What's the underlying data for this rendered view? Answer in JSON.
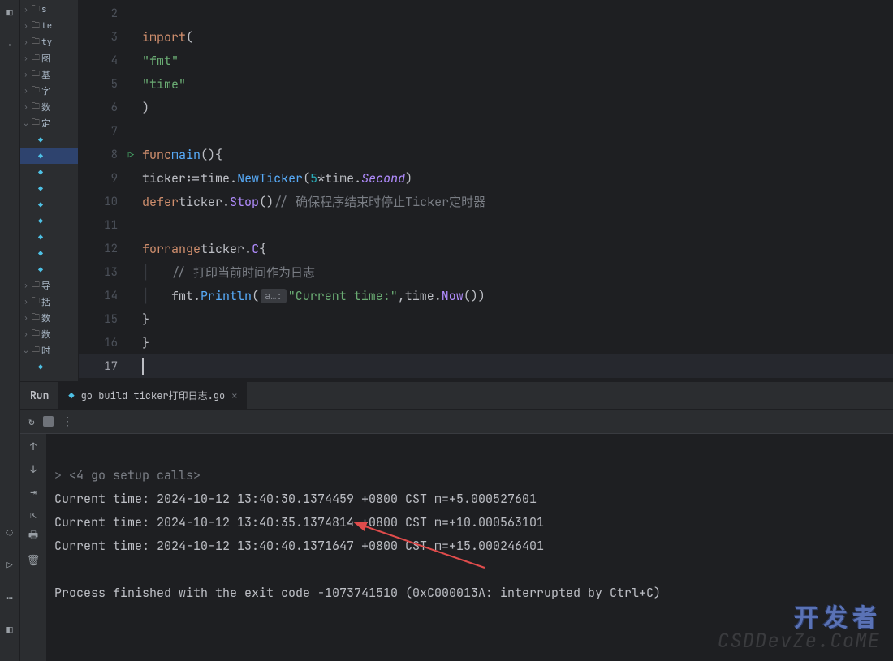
{
  "project_tree": {
    "items": [
      {
        "kind": "folder",
        "chevron": ">",
        "label": "s"
      },
      {
        "kind": "folder",
        "chevron": ">",
        "label": "te"
      },
      {
        "kind": "folder",
        "chevron": ">",
        "label": "ty"
      },
      {
        "kind": "folder",
        "chevron": ">",
        "label": "图"
      },
      {
        "kind": "folder",
        "chevron": ">",
        "label": "基"
      },
      {
        "kind": "folder",
        "chevron": ">",
        "label": "字"
      },
      {
        "kind": "folder",
        "chevron": ">",
        "label": "数"
      },
      {
        "kind": "folder",
        "chevron": "v",
        "label": "定"
      },
      {
        "kind": "go",
        "label": ""
      },
      {
        "kind": "go",
        "label": "",
        "selected": true
      },
      {
        "kind": "go",
        "label": ""
      },
      {
        "kind": "go",
        "label": ""
      },
      {
        "kind": "go",
        "label": ""
      },
      {
        "kind": "go",
        "label": ""
      },
      {
        "kind": "go",
        "label": ""
      },
      {
        "kind": "go",
        "label": ""
      },
      {
        "kind": "go",
        "label": ""
      },
      {
        "kind": "folder",
        "chevron": ">",
        "label": "导"
      },
      {
        "kind": "folder",
        "chevron": ">",
        "label": "括"
      },
      {
        "kind": "folder",
        "chevron": ">",
        "label": "数"
      },
      {
        "kind": "folder",
        "chevron": ">",
        "label": "数"
      },
      {
        "kind": "folder",
        "chevron": "v",
        "label": "时"
      },
      {
        "kind": "go",
        "label": ""
      }
    ]
  },
  "gutter": {
    "lines": [
      "2",
      "3",
      "4",
      "5",
      "6",
      "7",
      "8",
      "9",
      "10",
      "11",
      "12",
      "13",
      "14",
      "15",
      "16",
      "17"
    ],
    "run_icon_at": "8",
    "current_line": "17"
  },
  "code": {
    "l3_kw": "import",
    "l3_open": "(",
    "l4_str": "\"fmt\"",
    "l5_str": "\"time\"",
    "l6_close": ")",
    "l8_func": "func",
    "l8_name": "main",
    "l8_parens": "()",
    "l8_brace": "{",
    "l9_ticker": "ticker",
    "l9_assign": ":=",
    "l9_time": "time",
    "l9_dot1": ".",
    "l9_new": "NewTicker",
    "l9_open": "(",
    "l9_num": "5",
    "l9_star": "*",
    "l9_time2": "time",
    "l9_dot2": ".",
    "l9_sec": "Second",
    "l9_close": ")",
    "l10_defer": "defer",
    "l10_ticker": "ticker",
    "l10_dot": ".",
    "l10_stop": "Stop",
    "l10_parens": "()",
    "l10_comment": "// 确保程序结束时停止Ticker定时器",
    "l12_for": "for",
    "l12_range": "range",
    "l12_ticker": "ticker",
    "l12_dot": ".",
    "l12_c": "C",
    "l12_brace": "{",
    "l13_comment": "// 打印当前时间作为日志",
    "l14_fmt": "fmt",
    "l14_dot": ".",
    "l14_println": "Println",
    "l14_open": "(",
    "l14_hint": "a…:",
    "l14_str": "\"Current time:\"",
    "l14_comma": ",",
    "l14_time": "time",
    "l14_dot2": ".",
    "l14_now": "Now",
    "l14_parens": "()",
    "l14_close": ")",
    "l15_brace": "}",
    "l16_brace": "}"
  },
  "run": {
    "title": "Run",
    "tab_label": "go build ticker打印日志.go",
    "setup_line": "<4 go setup calls>",
    "output": [
      "Current time: 2024-10-12 13:40:30.1374459 +0800 CST m=+5.000527601",
      "Current time: 2024-10-12 13:40:35.1374814 +0800 CST m=+10.000563101",
      "Current time: 2024-10-12 13:40:40.1371647 +0800 CST m=+15.000246401"
    ],
    "exit_line": "Process finished with the exit code -1073741510 (0xC000013A: interrupted by Ctrl+C)"
  },
  "watermark": "CSDDevZe.CoME",
  "watermark2": "开发者"
}
